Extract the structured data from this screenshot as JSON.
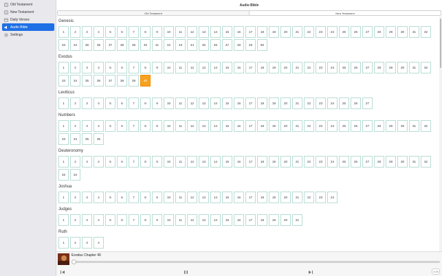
{
  "app_title": "Audio Bible",
  "sidebar": {
    "items": [
      {
        "label": "Old Testament",
        "icon": "book-icon",
        "active": false
      },
      {
        "label": "New Testament",
        "icon": "book-icon",
        "active": false
      },
      {
        "label": "Daily Verses",
        "icon": "calendar-icon",
        "active": false
      },
      {
        "label": "Audio Bible",
        "icon": "speaker-icon",
        "active": true
      },
      {
        "label": "Settings",
        "icon": "gear-icon",
        "active": false
      }
    ]
  },
  "tabs": [
    {
      "label": "Old Testament",
      "selected": true
    },
    {
      "label": "New Testament",
      "selected": false
    }
  ],
  "books": [
    {
      "name": "Genesis",
      "chapters": 50
    },
    {
      "name": "Exodus",
      "chapters": 40,
      "active_chapter": 40
    },
    {
      "name": "Leviticus",
      "chapters": 27
    },
    {
      "name": "Numbers",
      "chapters": 36
    },
    {
      "name": "Deuteronomy",
      "chapters": 34
    },
    {
      "name": "Joshua",
      "chapters": 24
    },
    {
      "name": "Judges",
      "chapters": 21
    },
    {
      "name": "Ruth",
      "chapters": 4
    }
  ],
  "player": {
    "track_title": "Exodus Chapter 40",
    "progress": 0.0,
    "speed": "1.0x",
    "icons": {
      "back": "skip-back-icon",
      "play": "pause-icon",
      "forward": "skip-forward-icon"
    }
  }
}
